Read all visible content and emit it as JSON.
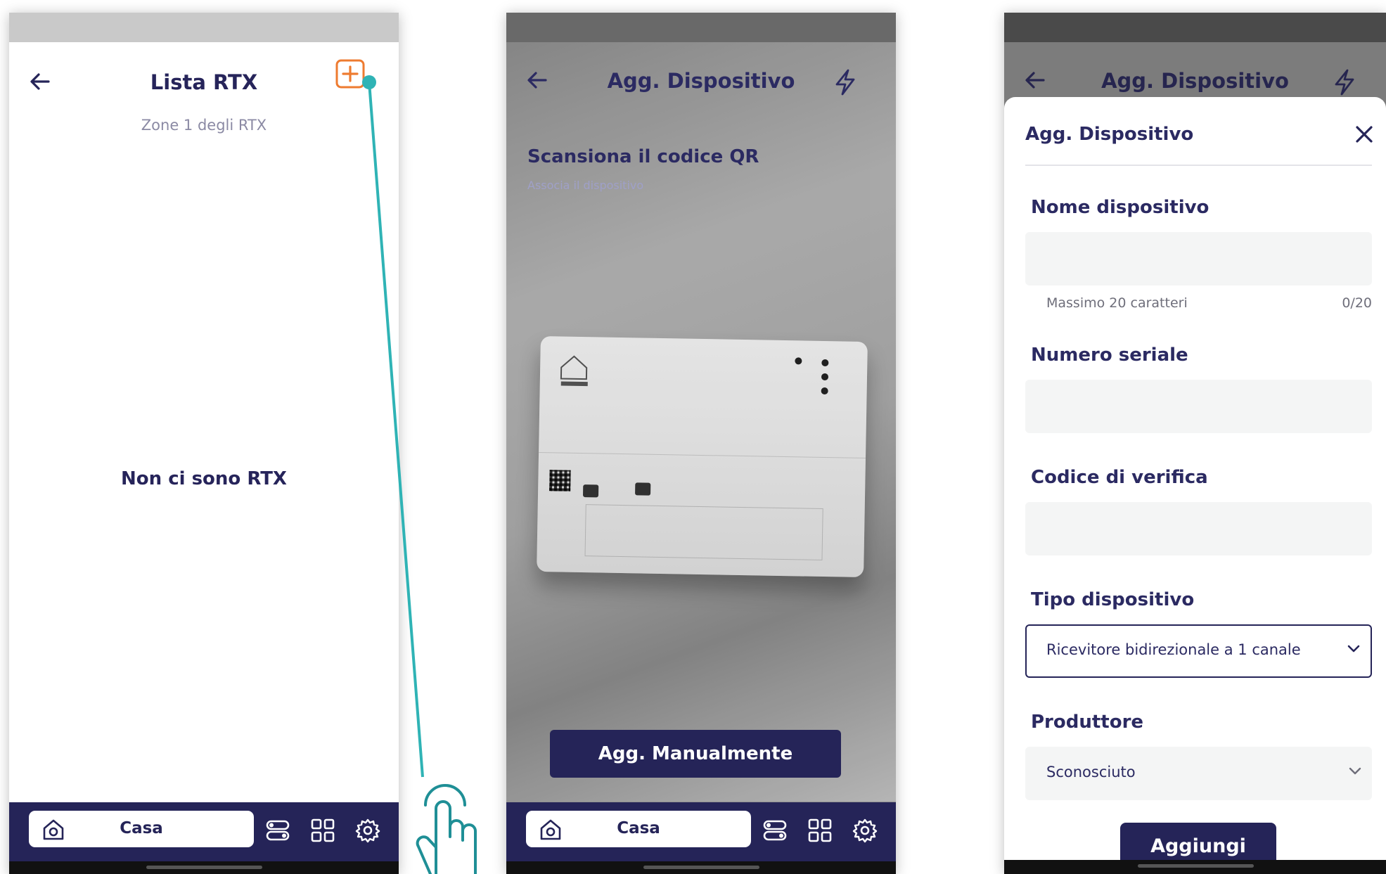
{
  "screen1": {
    "title": "Lista RTX",
    "subtitle": "Zone 1 degli RTX",
    "empty_message": "Non ci sono RTX",
    "nav": {
      "home_label": "Casa"
    }
  },
  "screen2": {
    "title": "Agg. Dispositivo",
    "scan_title": "Scansiona il codice QR",
    "scan_subtitle": "Associa il dispositivo",
    "manual_button": "Agg. Manualmente",
    "nav": {
      "home_label": "Casa"
    }
  },
  "screen3": {
    "header_title": "Agg. Dispositivo",
    "sheet_title": "Agg. Dispositivo",
    "fields": {
      "name_label": "Nome dispositivo",
      "name_value": "",
      "name_hint": "Massimo 20 caratteri",
      "name_counter": "0/20",
      "serial_label": "Numero seriale",
      "serial_value": "",
      "code_label": "Codice di verifica",
      "code_value": "",
      "type_label": "Tipo dispositivo",
      "type_value": "Ricevitore bidirezionale a 1 canale",
      "producer_label": "Produttore",
      "producer_value": "Sconosciuto"
    },
    "submit_button": "Aggiungi"
  },
  "colors": {
    "primary": "#252458",
    "accent_orange": "#ee7b30",
    "annotation_teal": "#2fb3b5"
  }
}
